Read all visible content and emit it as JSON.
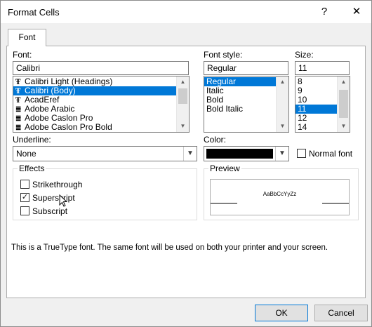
{
  "window": {
    "title": "Format Cells",
    "help_label": "?",
    "close_label": "✕"
  },
  "tabs": [
    {
      "label": "Font"
    }
  ],
  "font": {
    "label": "Font:",
    "value": "Calibri",
    "items": [
      "Calibri Light (Headings)",
      "Calibri (Body)",
      "AcadEref",
      "Adobe Arabic",
      "Adobe Caslon Pro",
      "Adobe Caslon Pro Bold"
    ],
    "item_icons": [
      "truetype-icon",
      "truetype-icon",
      "truetype-icon",
      "printer-font-icon",
      "printer-font-icon",
      "printer-font-icon"
    ],
    "icon_glyphs": [
      "Ŧ",
      "Ŧ",
      "Ŧ",
      "≣",
      "≣",
      "≣"
    ],
    "selected": "Calibri (Body)"
  },
  "font_style": {
    "label": "Font style:",
    "value": "Regular",
    "items": [
      "Regular",
      "Italic",
      "Bold",
      "Bold Italic"
    ],
    "selected": "Regular"
  },
  "size": {
    "label": "Size:",
    "value": "11",
    "items": [
      "8",
      "9",
      "10",
      "11",
      "12",
      "14"
    ],
    "selected": "11"
  },
  "underline": {
    "label": "Underline:",
    "value": "None"
  },
  "color": {
    "label": "Color:",
    "swatch": "#000000"
  },
  "normal_font": {
    "label": "Normal font",
    "checked": false
  },
  "effects": {
    "label": "Effects",
    "strikethrough": {
      "label": "Strikethrough",
      "checked": false
    },
    "superscript": {
      "label": "Superscript",
      "checked": true
    },
    "subscript": {
      "label": "Subscript",
      "checked": false
    }
  },
  "preview": {
    "label": "Preview",
    "sample": "AaBbCcYyZz"
  },
  "info_text": "This is a TrueType font.  The same font will be used on both your printer and your screen.",
  "buttons": {
    "ok": "OK",
    "cancel": "Cancel"
  },
  "colors": {
    "selection": "#0078d7",
    "dialog_bg": "#f0f0f0"
  }
}
